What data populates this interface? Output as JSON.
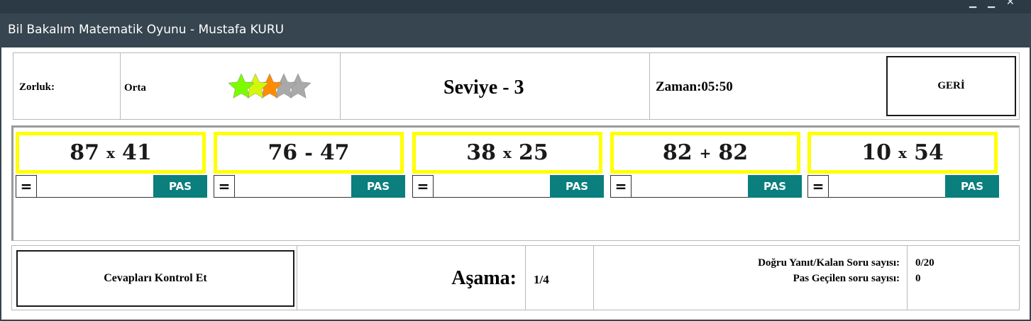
{
  "window": {
    "title": "Bil Bakalım Matematik Oyunu - Mustafa KURU",
    "controls": [
      "minimize-icon",
      "maximize-icon",
      "close-icon"
    ]
  },
  "header": {
    "difficulty_label": "Zorluk:",
    "difficulty_value": "Orta",
    "star_rating": {
      "filled": 3,
      "total": 5,
      "colors": [
        "#7cfc00",
        "#d4f80b",
        "#ff8c00",
        "#a9a9a9",
        "#a9a9a9"
      ]
    },
    "level_label": "Seviye - 3",
    "time_label": "Zaman:05:50",
    "back_button": "GERİ"
  },
  "questions": [
    {
      "a": "87",
      "op": "x",
      "b": "41",
      "eq": "=",
      "answer": "",
      "pass": "PAS"
    },
    {
      "a": "76",
      "op": "-",
      "b": "47",
      "eq": "=",
      "answer": "",
      "pass": "PAS"
    },
    {
      "a": "38",
      "op": "x",
      "b": "25",
      "eq": "=",
      "answer": "",
      "pass": "PAS"
    },
    {
      "a": "82",
      "op": "+",
      "b": "82",
      "eq": "=",
      "answer": "",
      "pass": "PAS"
    },
    {
      "a": "10",
      "op": "x",
      "b": "54",
      "eq": "=",
      "answer": "",
      "pass": "PAS"
    }
  ],
  "footer": {
    "check_button": "Cevapları Kontrol Et",
    "stage_label": "Aşama:",
    "stage_value": "1/4",
    "correct_label": "Doğru Yanıt/Kalan Soru sayısı:",
    "correct_value": "0/20",
    "passed_label": "Pas Geçilen soru sayısı:",
    "passed_value": "0"
  },
  "colors": {
    "titlebar": "#36454f",
    "question_border": "#ffff00",
    "pass_button": "#0b7e7e"
  }
}
